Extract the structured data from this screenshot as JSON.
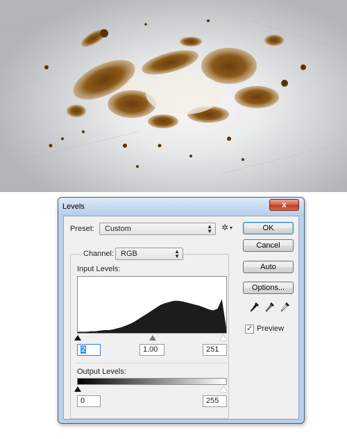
{
  "window": {
    "title": "Levels",
    "close_glyph": "x"
  },
  "preset": {
    "label": "Preset:",
    "value": "Custom",
    "menu_icon": "gear-icon"
  },
  "channel": {
    "label": "Channel:",
    "value": "RGB"
  },
  "input_levels": {
    "label": "Input Levels:",
    "black": "2",
    "gamma": "1.00",
    "white": "251",
    "histogram_profile": [
      0.02,
      0.02,
      0.02,
      0.03,
      0.03,
      0.04,
      0.05,
      0.05,
      0.06,
      0.08,
      0.1,
      0.13,
      0.16,
      0.2,
      0.25,
      0.3,
      0.35,
      0.4,
      0.45,
      0.5,
      0.53,
      0.55,
      0.57,
      0.57,
      0.56,
      0.54,
      0.52,
      0.5,
      0.48,
      0.45,
      0.42,
      0.4,
      0.43,
      0.6,
      0.1
    ]
  },
  "output_levels": {
    "label": "Output Levels:",
    "black": "0",
    "white": "255"
  },
  "buttons": {
    "ok": "OK",
    "cancel": "Cancel",
    "auto": "Auto",
    "options": "Options..."
  },
  "preview": {
    "label": "Preview",
    "checked": true,
    "check_glyph": "✓"
  },
  "eyedroppers": [
    "black-point-eyedropper-icon",
    "gray-point-eyedropper-icon",
    "white-point-eyedropper-icon"
  ],
  "colors": {
    "accent": "#3399ff",
    "titlebar": "#c4d8ee",
    "close": "#c94a33"
  }
}
